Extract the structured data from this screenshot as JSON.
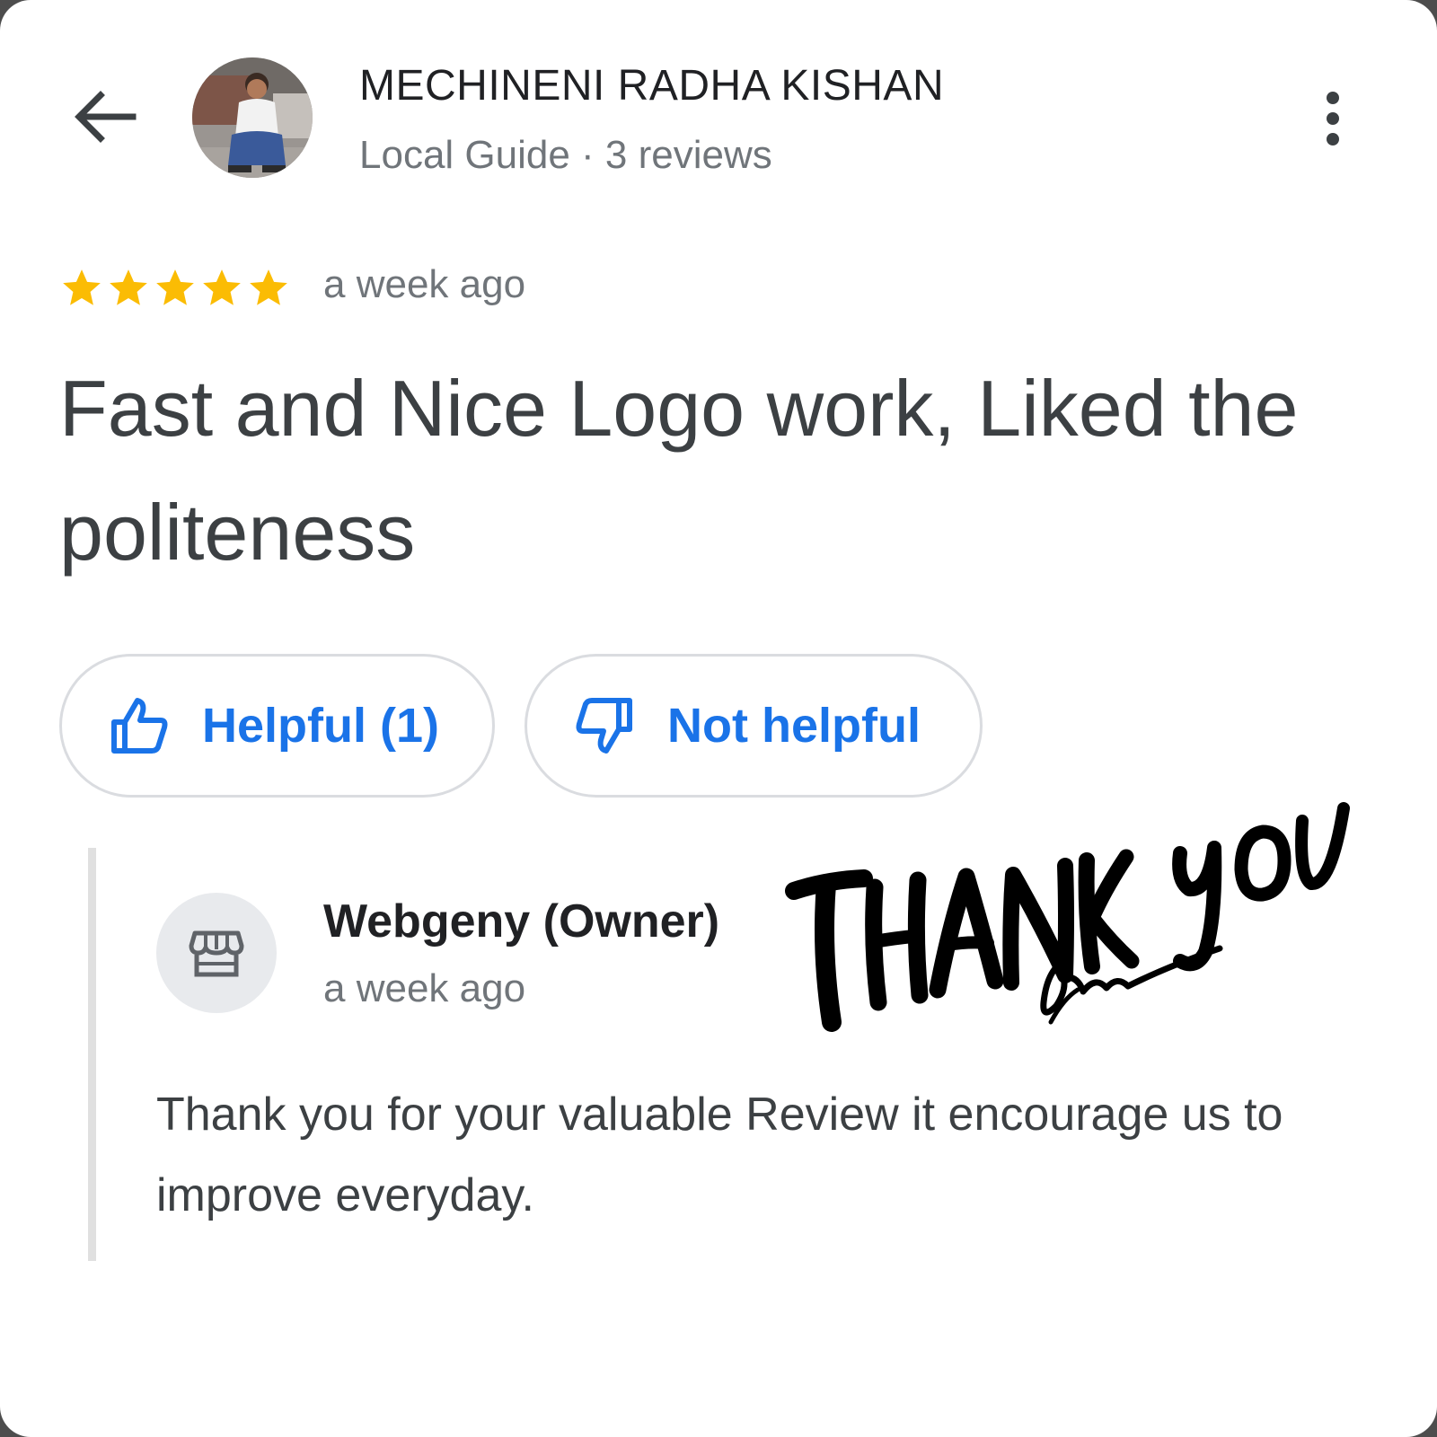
{
  "header": {
    "reviewer_name": "MECHINENI RADHA KISHAN",
    "reviewer_meta": "Local Guide · 3 reviews",
    "back_icon": "arrow-back-icon",
    "menu_icon": "more-vert-icon"
  },
  "review": {
    "rating": 5,
    "rating_max": 5,
    "time": "a week ago",
    "text": "Fast and Nice Logo work, Liked the politeness"
  },
  "actions": {
    "helpful_label": "Helpful (1)",
    "not_helpful_label": "Not helpful",
    "accent_color": "#1a73e8"
  },
  "owner_reply": {
    "name": "Webgeny (Owner)",
    "time": "a week ago",
    "text": "Thank you for your valuable Review it encourage us to improve everyday.",
    "avatar_icon": "storefront-icon"
  },
  "overlay": {
    "handwritten_text": "THANK YOU"
  },
  "colors": {
    "star": "#fbbc04",
    "text_primary": "#202124",
    "text_secondary": "#70757a"
  }
}
